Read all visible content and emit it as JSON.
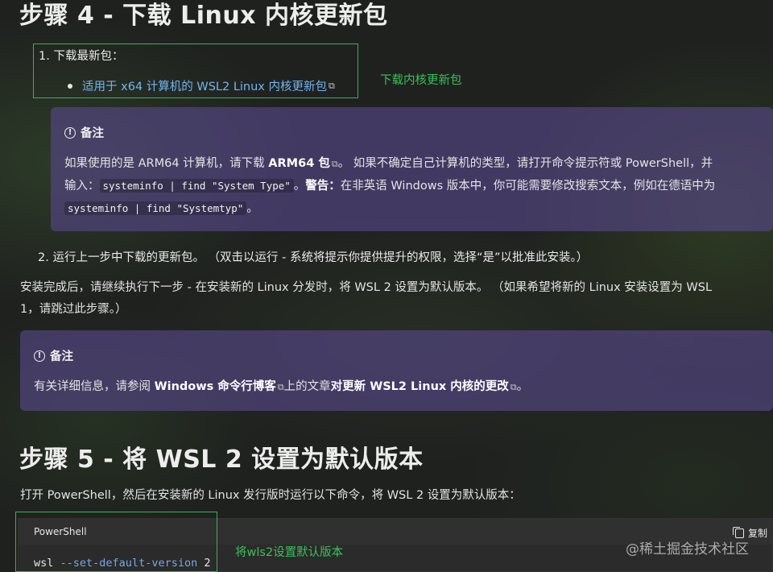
{
  "step4": {
    "title": "步骤 4 - 下载 Linux 内核更新包",
    "item1_label": "1. 下载最新包：",
    "item1_link": "适用于 x64 计算机的 WSL2 Linux 内核更新包",
    "annotation1": "下载内核更新包",
    "note1": {
      "heading": "备注",
      "p1": "如果使用的是 ARM64 计算机，请下载 ",
      "p1_link": "ARM64 包",
      "p2": "。 如果不确定自己计算机的类型，请打开命令提示符或 PowerShell，并",
      "p3": "输入：",
      "code1": "systeminfo | find \"System Type\"",
      "p4": "。",
      "warn_label": "警告：",
      "p5": "在非英语 Windows 版本中，你可能需要修改搜索文本，例如在德语中为",
      "code2": "systeminfo | find \"Systemtyp\"",
      "p6": "。"
    },
    "item2": "2. 运行上一步中下载的更新包。 （双击以运行 - 系统将提示你提供提升的权限，选择“是”以批准此安装。）",
    "after_install_line1": "安装完成后，请继续执行下一步 - 在安装新的 Linux 分发时，将 WSL 2 设置为默认版本。 （如果希望将新的 Linux 安装设置为 WSL",
    "after_install_line2": "1，请跳过此步骤。）",
    "note2": {
      "heading": "备注",
      "p1": "有关详细信息，请参阅 ",
      "link1": "Windows 命令行博客",
      "p2": "上的文章",
      "link2": "对更新 WSL2 Linux 内核的更改",
      "p3": "。"
    }
  },
  "step5": {
    "title": "步骤 5 - 将 WSL 2 设置为默认版本",
    "desc": "打开 PowerShell，然后在安装新的 Linux 发行版时运行以下命令，将 WSL 2 设置为默认版本：",
    "code_lang": "PowerShell",
    "copy_label": "复制",
    "cmd": "wsl",
    "cmd_arg": "--set-default-version",
    "cmd_val": "2",
    "annotation2": "将wls2设置默认版本"
  },
  "watermark": "@稀土掘金技术社区",
  "colors": {
    "annotation_green": "#3fbf5b",
    "link_blue": "#72b5f2",
    "note_purple": "#58488c"
  }
}
